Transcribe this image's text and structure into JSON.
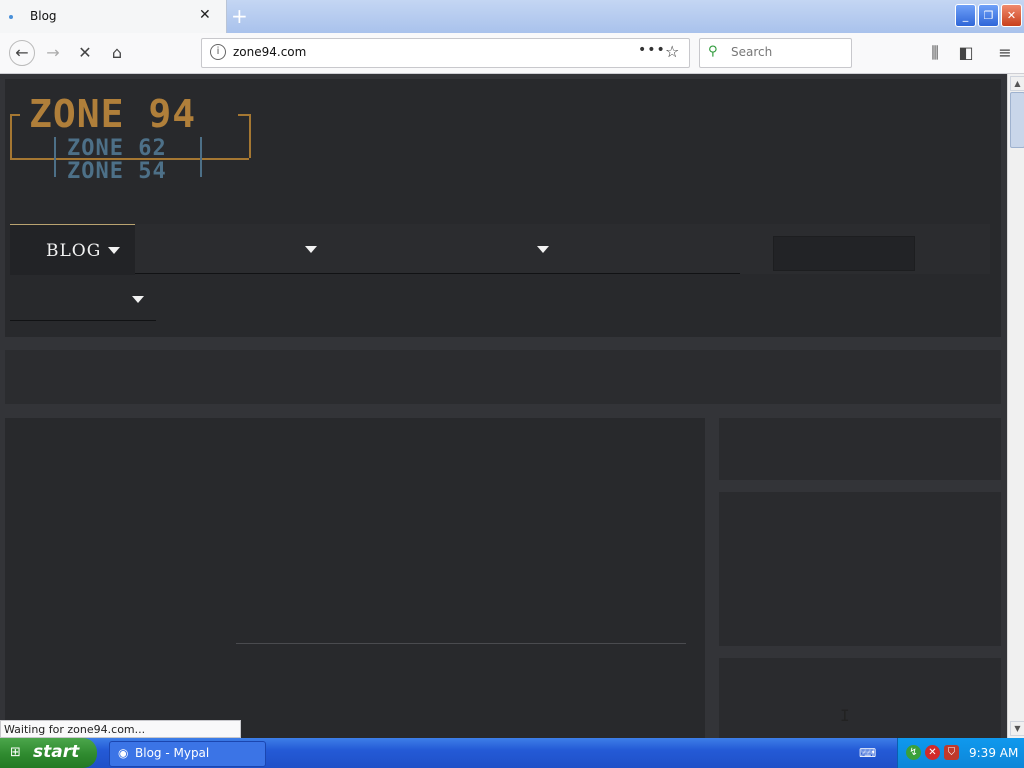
{
  "browser": {
    "tab": {
      "title": "Blog"
    },
    "url": "zone94.com",
    "search_placeholder": "Search",
    "status_text": "Waiting for zone94.com..."
  },
  "site": {
    "logo": {
      "main": "ZONE 94",
      "sub1": "ZONE 62",
      "sub2": "ZONE 54"
    },
    "menu": {
      "blog_label": "BLOG"
    }
  },
  "taskbar": {
    "start_label": "start",
    "task_label": "Blog - Mypal",
    "clock": "9:39 AM"
  },
  "colors": {
    "logo_gold": "#b07f3a",
    "logo_steel": "#4d7088",
    "page_bg": "#333438",
    "panel_bg": "#28292c"
  }
}
